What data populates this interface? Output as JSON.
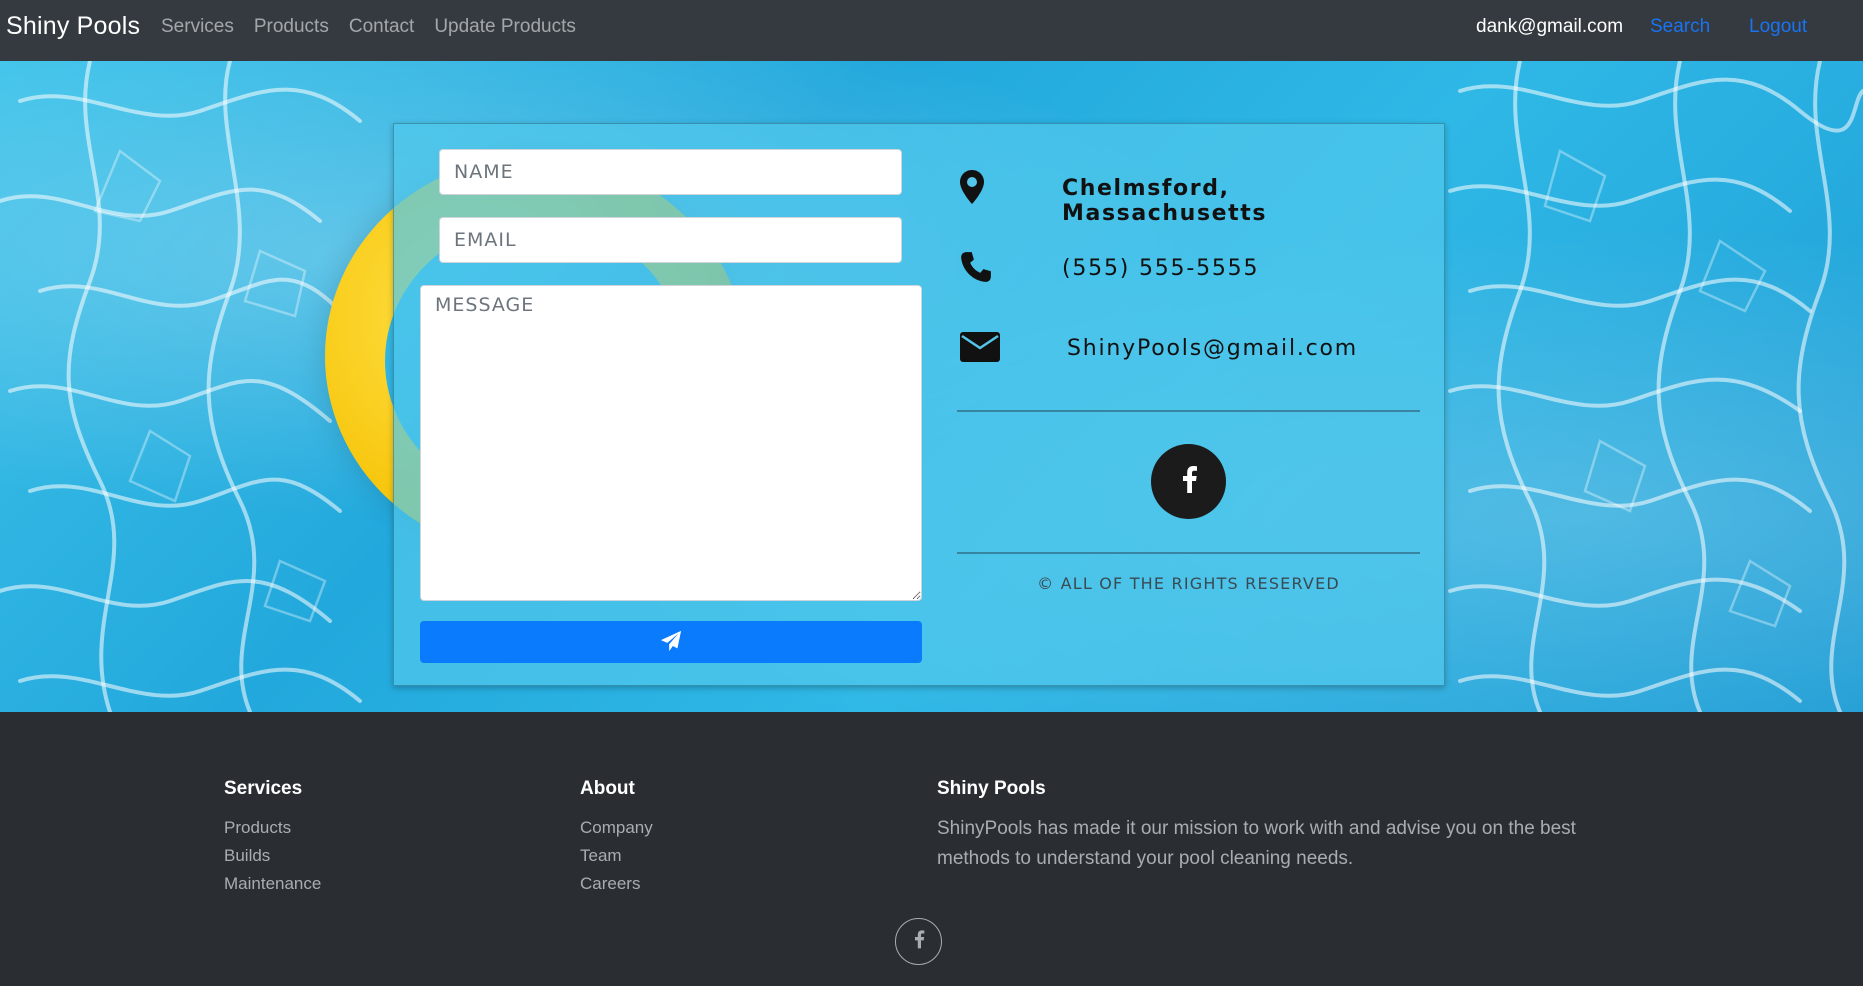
{
  "navbar": {
    "brand": "Shiny Pools",
    "links": [
      "Services",
      "Products",
      "Contact",
      "Update Products"
    ],
    "user_email": "dank@gmail.com",
    "search_label": "Search",
    "logout_label": "Logout"
  },
  "contact_form": {
    "name_placeholder": "NAME",
    "email_placeholder": "EMAIL",
    "message_placeholder": "MESSAGE",
    "send_icon": "paper-plane-icon"
  },
  "contact_info": {
    "location": "Chelmsford, Massachusetts",
    "phone": "(555) 555-5555",
    "email": "ShinyPools@gmail.com",
    "social_icon": "facebook-icon",
    "rights": "© ALL OF THE RIGHTS RESERVED"
  },
  "footer": {
    "services": {
      "heading": "Services",
      "links": [
        "Products",
        "Builds",
        "Maintenance"
      ]
    },
    "about": {
      "heading": "About",
      "links": [
        "Company",
        "Team",
        "Careers"
      ]
    },
    "brand": {
      "heading": "Shiny Pools",
      "description": "ShinyPools has made it our mission to work with and advise you on the best methods to understand your pool cleaning needs."
    },
    "social_icon": "facebook-icon"
  },
  "colors": {
    "navbar_bg": "#343a40",
    "footer_bg": "#2a2e33",
    "accent_blue": "#0a7bfc",
    "link_blue": "#1a73f0",
    "pool_blue": "#2fb8e6"
  }
}
